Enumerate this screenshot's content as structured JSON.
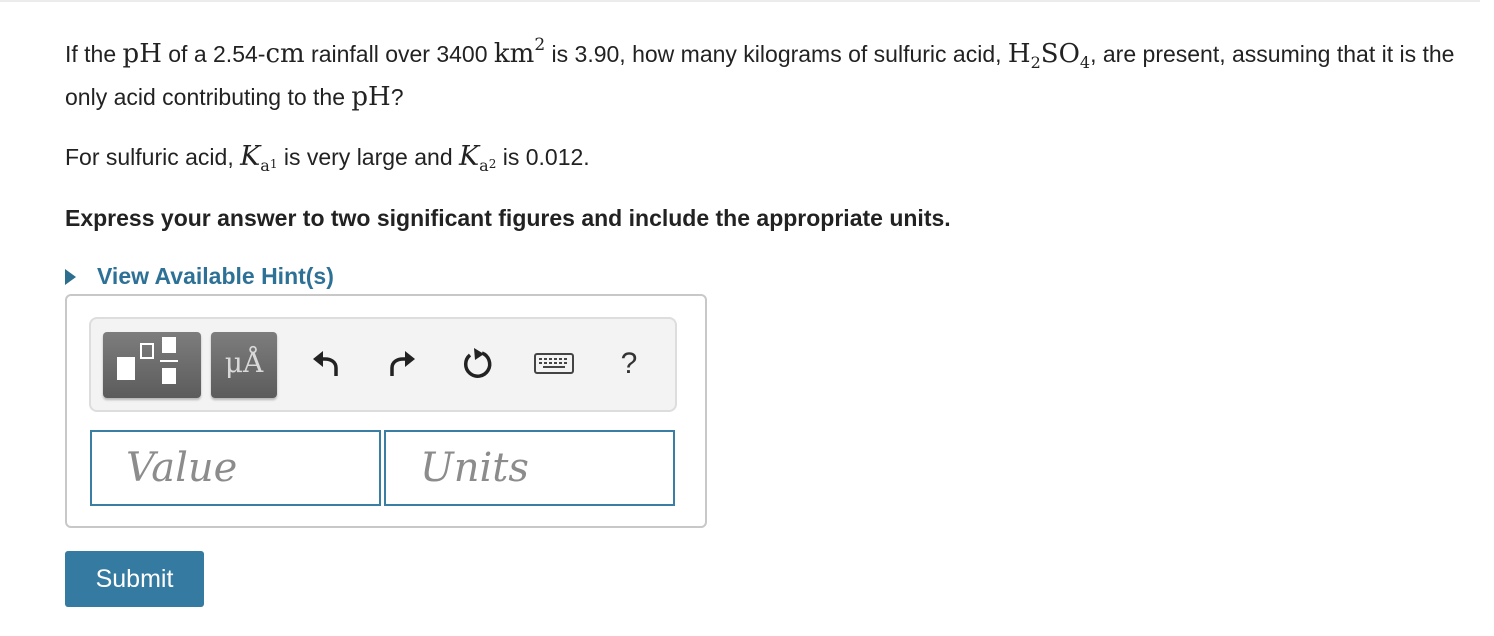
{
  "question": {
    "p1": "If the ",
    "ph": "pH",
    "p2": " of a 2.54-",
    "cm": "cm",
    "p3": " rainfall over 3400 ",
    "km": "km",
    "km_exp": "2",
    "p4": " is 3.90, how  many kilograms of sulfuric acid, ",
    "h": "H",
    "h_sub": "2",
    "so": "SO",
    "so_sub": "4",
    "p5": ", are present, assuming that it is the only acid contributing to the ",
    "ph2": "pH",
    "p6": "?"
  },
  "ka_line": {
    "p1": "For sulfuric acid, ",
    "k": "K",
    "a": "a",
    "n1": "1",
    "p2": " is very large and ",
    "n2": "2",
    "p3": " is 0.012."
  },
  "instruction": "Express your answer to two significant figures and include the appropriate units.",
  "hint": {
    "label": "View Available Hint(s)"
  },
  "toolbar": {
    "units_label": "μÅ",
    "help_label": "?",
    "icons": [
      "templates-icon",
      "units-icon",
      "undo-icon",
      "redo-icon",
      "reset-icon",
      "keyboard-icon",
      "help-icon"
    ]
  },
  "inputs": {
    "value_placeholder": "Value",
    "units_placeholder": "Units"
  },
  "submit_label": "Submit",
  "colors": {
    "accent": "#357aa0",
    "link": "#2e7196",
    "field_border": "#3a7ea3"
  }
}
